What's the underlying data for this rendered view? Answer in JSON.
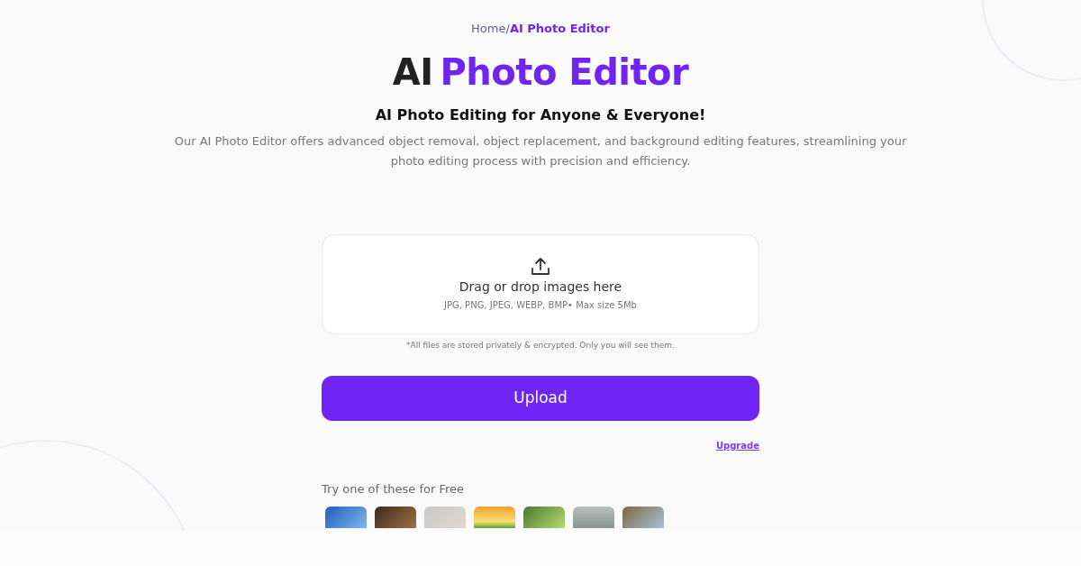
{
  "breadcrumb": {
    "home": "Home",
    "separator": "/",
    "current": "AI Photo Editor"
  },
  "title": {
    "plain": "AI",
    "accent": "Photo Editor"
  },
  "subtitle": "AI Photo Editing for Anyone & Everyone!",
  "description": "Our AI Photo Editor offers advanced object removal, object replacement, and background editing features, streamlining your photo editing process with precision and efficiency.",
  "dropzone": {
    "label": "Drag or drop images here",
    "formats": "JPG, PNG, JPEG, WEBP, BMP• Max size 5Mb"
  },
  "privacy_note": "*All files are stored privately & encrypted. Only you will see them.",
  "upload_button": "Upload",
  "upgrade_link": "Upgrade",
  "samples_heading": "Try one of these for Free",
  "samples": [
    {
      "kind": "photo"
    },
    {
      "kind": "photo"
    },
    {
      "kind": "photo"
    },
    {
      "kind": "photo"
    },
    {
      "kind": "photo"
    },
    {
      "kind": "photo"
    },
    {
      "kind": "photo"
    }
  ]
}
